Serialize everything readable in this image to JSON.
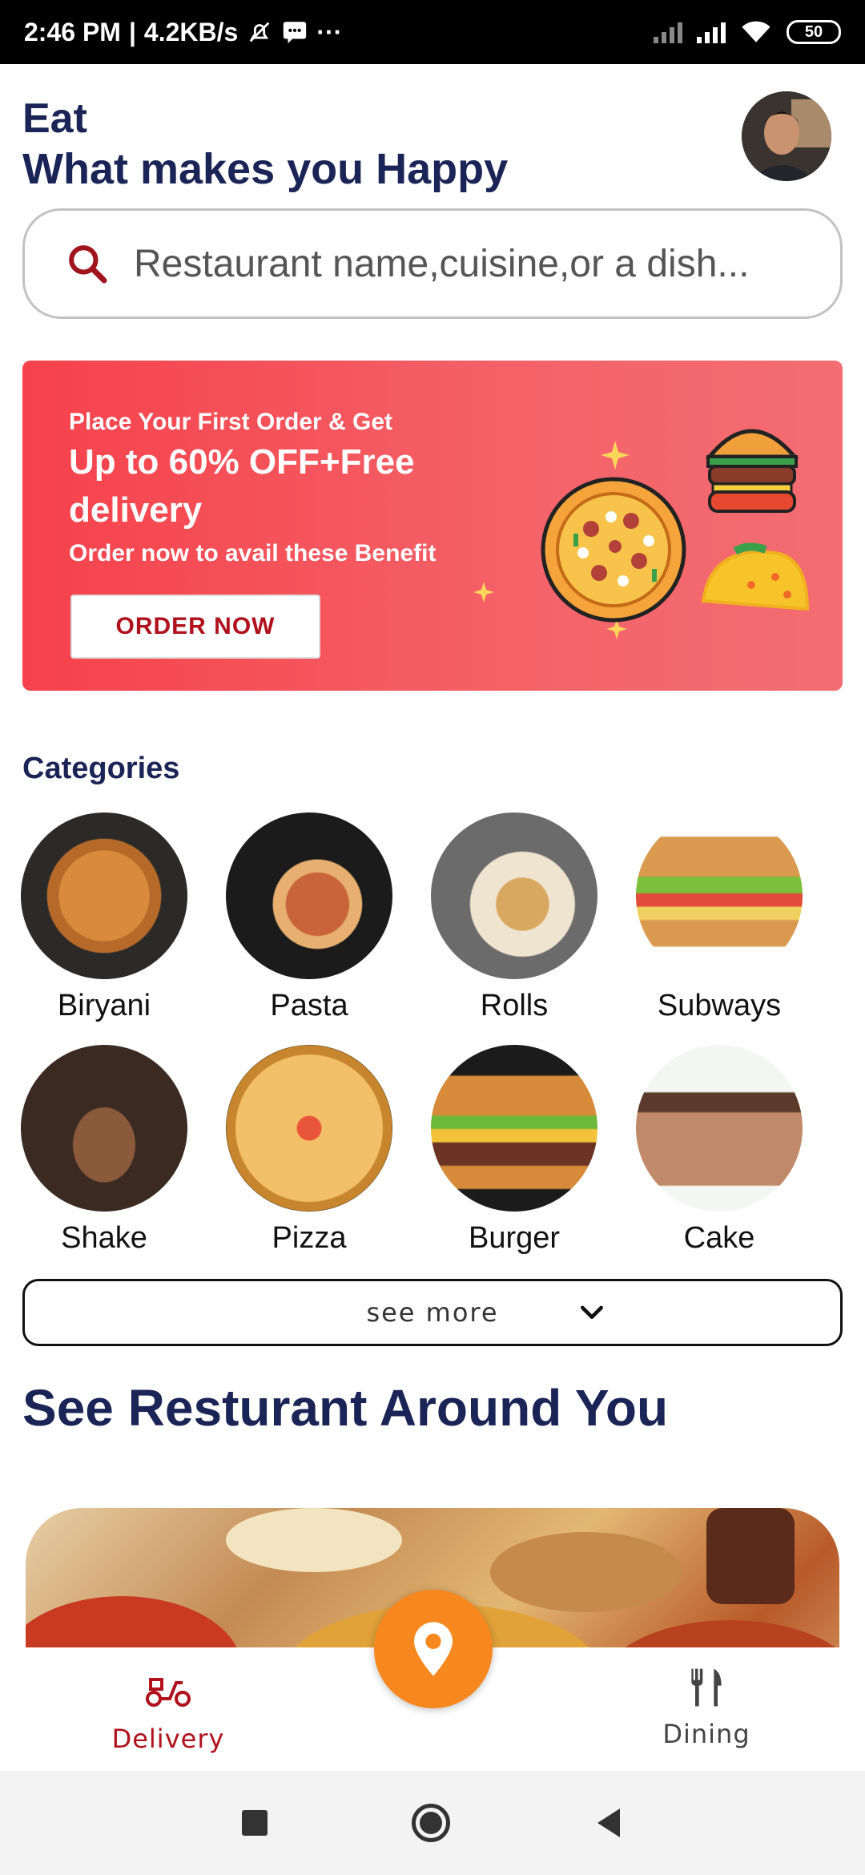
{
  "status_bar": {
    "time": "2:46 PM",
    "speed": "4.2KB/s",
    "more": "···",
    "battery": "50"
  },
  "header": {
    "title_line1": "Eat",
    "title_line2": "What makes you Happy"
  },
  "search": {
    "placeholder": "Restaurant name,cuisine,or a dish..."
  },
  "banner": {
    "small_text": "Place Your First Order & Get",
    "headline_line1": "Up to 60% OFF+Free",
    "headline_line2": "delivery",
    "subtext": "Order now to avail these Benefit",
    "button_label": "ORDER NOW"
  },
  "categories": {
    "title": "Categories",
    "items": [
      {
        "label": "Biryani"
      },
      {
        "label": "Pasta"
      },
      {
        "label": "Rolls"
      },
      {
        "label": "Subways"
      },
      {
        "label": "Shake"
      },
      {
        "label": "Pizza"
      },
      {
        "label": "Burger"
      },
      {
        "label": "Cake"
      }
    ],
    "see_more_label": "see more"
  },
  "restaurants": {
    "title": "See Resturant Around You"
  },
  "bottom_nav": {
    "delivery_label": "Delivery",
    "dining_label": "Dining"
  },
  "colors": {
    "primary_text": "#1b2456",
    "banner_red": "#f6414b",
    "accent_orange": "#f7881f",
    "delivery_active": "#b0111c"
  }
}
